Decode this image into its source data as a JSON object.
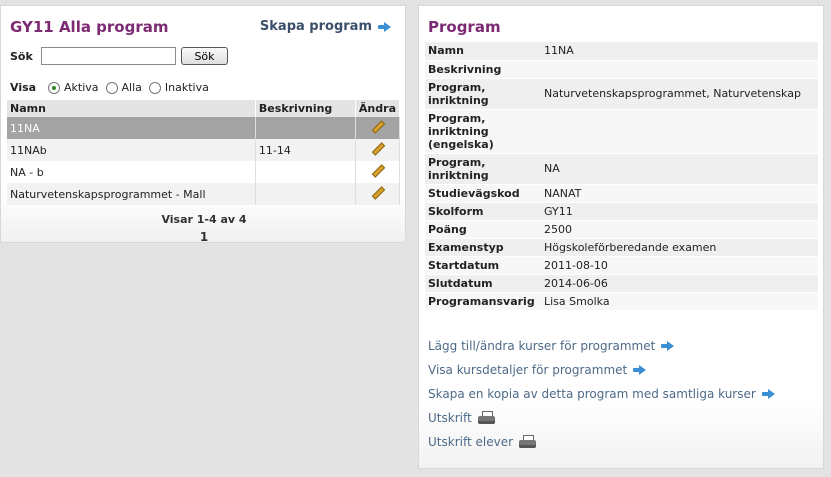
{
  "left": {
    "title": "GY11 Alla program",
    "create_link": "Skapa program",
    "search": {
      "label": "Sök",
      "value": "",
      "placeholder": "",
      "button": "Sök"
    },
    "filter": {
      "label": "Visa",
      "options": [
        "Aktiva",
        "Alla",
        "Inaktiva"
      ],
      "selected": "Aktiva"
    },
    "table": {
      "columns": [
        "Namn",
        "Beskrivning",
        "Ändra"
      ],
      "rows": [
        {
          "name": "11NA",
          "description": ""
        },
        {
          "name": "11NAb",
          "description": "11-14"
        },
        {
          "name": "NA - b",
          "description": ""
        },
        {
          "name": "Naturvetenskapsprogrammet - Mall",
          "description": ""
        }
      ]
    },
    "pager": {
      "info": "Visar 1-4 av 4",
      "page": "1"
    }
  },
  "right": {
    "title": "Program",
    "details": [
      {
        "key": "Namn",
        "value": "11NA"
      },
      {
        "key": "Beskrivning",
        "value": ""
      },
      {
        "key": "Program, inriktning",
        "value": "Naturvetenskapsprogrammet, Naturvetenskap"
      },
      {
        "key": "Program, inriktning (engelska)",
        "value": ""
      },
      {
        "key": "Program, inriktning",
        "value": "NA"
      },
      {
        "key": "Studievägskod",
        "value": "NANAT"
      },
      {
        "key": "Skolform",
        "value": "GY11"
      },
      {
        "key": "Poäng",
        "value": "2500"
      },
      {
        "key": "Examenstyp",
        "value": "Högskoleförberedande examen"
      },
      {
        "key": "Startdatum",
        "value": "2011-08-10"
      },
      {
        "key": "Slutdatum",
        "value": "2014-06-06"
      },
      {
        "key": "Programansvarig",
        "value": "Lisa Smolka"
      }
    ],
    "links": {
      "add_courses": "Lägg till/ändra kurser för programmet",
      "show_course_details": "Visa kursdetaljer för programmet",
      "copy_program": "Skapa en kopia av detta program med samtliga kurser",
      "print": "Utskrift",
      "print_students": "Utskrift elever"
    }
  },
  "colors": {
    "title": "#7b2a73",
    "link": "#4e6a88",
    "arrow": "#3a8fd4",
    "selected_row": "#a3a3a3"
  },
  "icons": {
    "arrow": "arrow-right-icon",
    "edit": "pencil-icon",
    "print": "printer-icon"
  }
}
